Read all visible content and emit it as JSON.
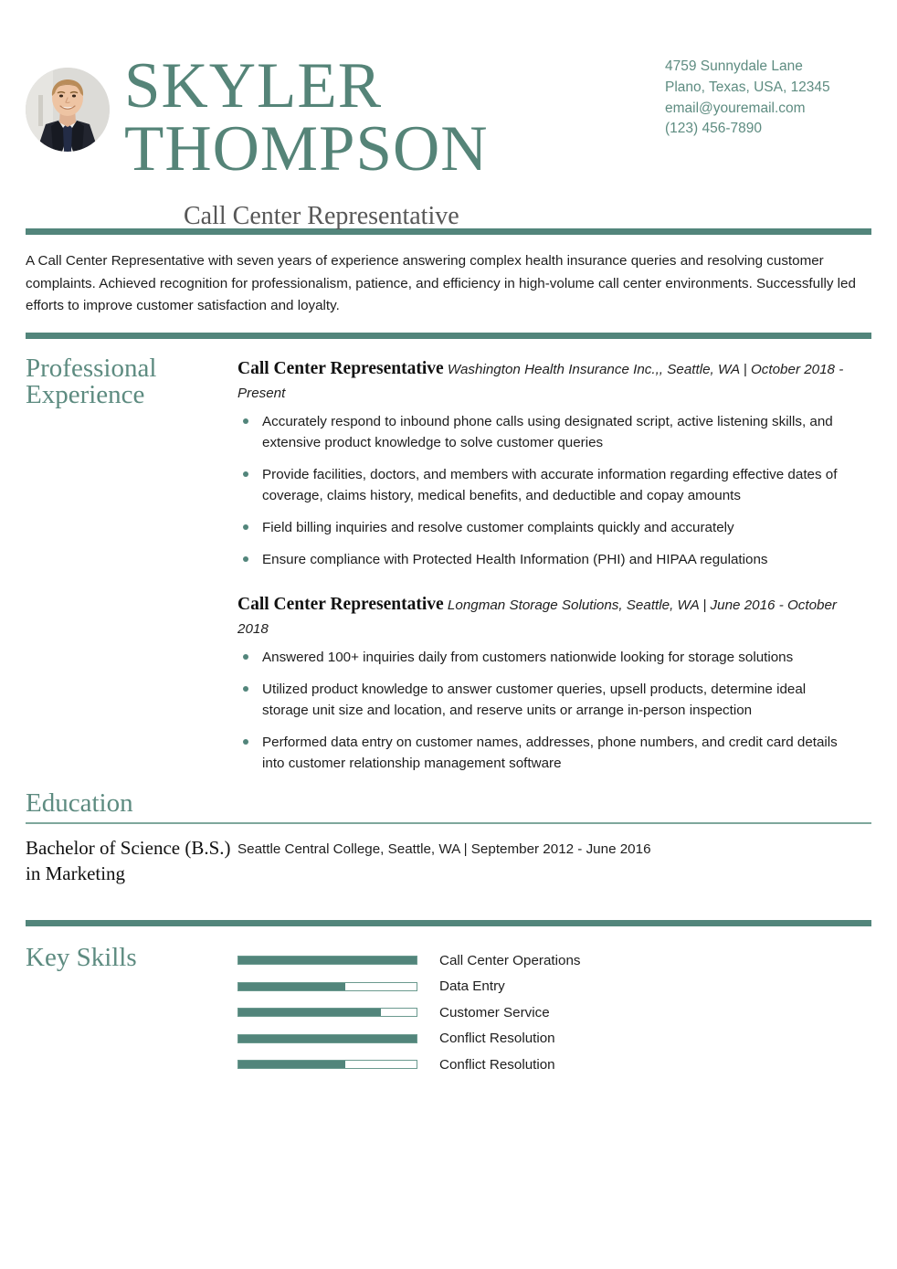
{
  "theme": {
    "accent": "#52857b",
    "accent_light": "#7ea79c",
    "name_color": "#558478",
    "subtitle_color": "#575757",
    "text_color": "#1d1d1d"
  },
  "header": {
    "avatar_alt": "profile-photo",
    "name_line_1": "SKYLER",
    "name_line_2": "THOMPSON",
    "job_subtitle": "Call Center Representative",
    "contact": [
      "4759 Sunnydale Lane",
      "Plano, Texas, USA, 12345",
      "email@youremail.com",
      "(123) 456-7890"
    ]
  },
  "summary": {
    "text": "A Call Center Representative with seven years of experience answering complex health insurance queries and resolving customer complaints. Achieved recognition for professionalism, patience, and efficiency in high-volume call center environments. Successfully led efforts to improve customer satisfaction and loyalty."
  },
  "experience": {
    "section_title_line_1": "Professional",
    "section_title_line_2": "Experience",
    "jobs": [
      {
        "title": "Call Center Representative",
        "meta": "Washington Health Insurance Inc.,, Seattle, WA | October 2018 - Present",
        "bullets": [
          "Accurately respond to inbound phone calls using designated script, active listening skills, and extensive product knowledge to solve customer queries",
          "Provide facilities, doctors, and members with accurate information regarding effective dates of coverage, claims history, medical benefits, and deductible and copay amounts",
          "Field billing inquiries and resolve customer complaints quickly and accurately",
          "Ensure compliance with Protected Health Information (PHI) and HIPAA regulations"
        ]
      },
      {
        "title": "Call Center Representative",
        "meta": "Longman Storage Solutions, Seattle, WA | June 2016 - October 2018",
        "bullets": [
          "Answered 100+ inquiries daily from customers nationwide looking for storage solutions",
          "Utilized product knowledge to answer customer queries, upsell products, determine ideal storage unit size and location, and reserve units or arrange in-person inspection",
          "Performed data entry on customer names, addresses, phone numbers, and credit card details into customer relationship management software"
        ]
      }
    ]
  },
  "education": {
    "section_title": "Education",
    "entries": [
      {
        "degree": "Bachelor of Science (B.S.) in Marketing",
        "meta": "Seattle Central College, Seattle, WA | September 2012 - June 2016"
      }
    ]
  },
  "skills": {
    "section_title": "Key Skills",
    "items": [
      {
        "label": "Call Center Operations",
        "level": 100
      },
      {
        "label": "Data Entry",
        "level": 60
      },
      {
        "label": "Customer Service",
        "level": 80
      },
      {
        "label": "Conflict Resolution",
        "level": 100
      },
      {
        "label": "Conflict Resolution",
        "level": 60
      }
    ]
  }
}
